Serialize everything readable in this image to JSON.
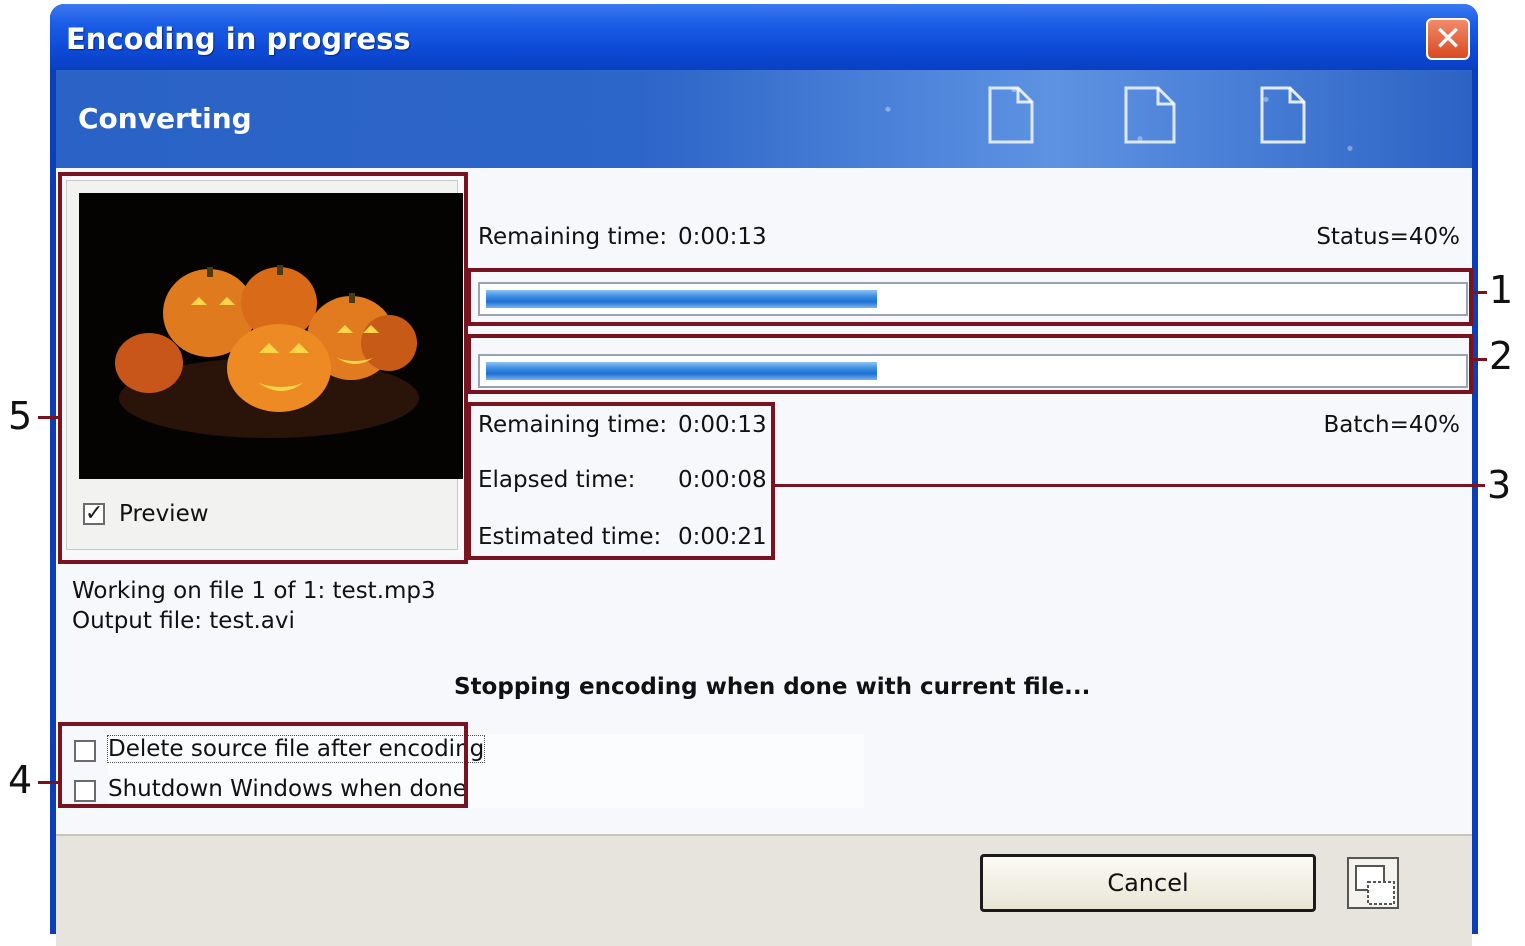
{
  "window": {
    "title": "Encoding in progress"
  },
  "header": {
    "section_title": "Converting"
  },
  "preview": {
    "checkbox_label": "Preview",
    "checked": true,
    "checkmark": "✓"
  },
  "status": {
    "remaining_label": "Remaining time:",
    "remaining_value": "0:00:13",
    "status_text": "Status=40%",
    "progress": 0.4
  },
  "batch": {
    "progress": 0.4,
    "batch_text": "Batch=40%",
    "remaining_label": "Remaining time:",
    "remaining_value": "0:00:13",
    "elapsed_label": "Elapsed time:",
    "elapsed_value": "0:00:08",
    "estimated_label": "Estimated time:",
    "estimated_value": "0:00:21"
  },
  "file_info": {
    "working_on": "Working on file 1 of 1: test.mp3",
    "output_file": "Output file: test.avi"
  },
  "message": "Stopping encoding when done with current file...",
  "options": {
    "delete_source": {
      "label": "Delete source file after encoding",
      "checked": false
    },
    "shutdown": {
      "label": "Shutdown Windows when done",
      "checked": false
    }
  },
  "footer": {
    "cancel_label": "Cancel"
  },
  "callouts": [
    "1",
    "2",
    "3",
    "4",
    "5"
  ],
  "icons": {
    "close": "close-icon",
    "documents": "document-icon",
    "restore": "restore-window-icon",
    "preview_image": "pumpkins-image"
  },
  "colors": {
    "title_bar": "#0c4ad6",
    "header_band": "#2d66c9",
    "progress_fill": "#1f6fd4",
    "highlight_box": "#7a1320"
  }
}
